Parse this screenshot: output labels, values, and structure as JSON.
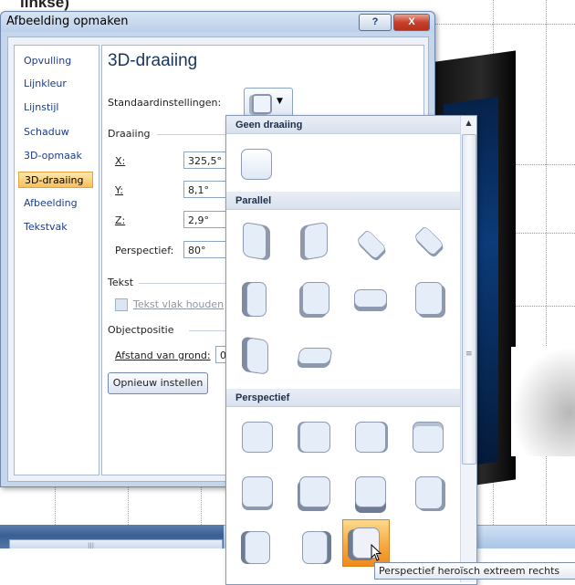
{
  "slide": {
    "top_text": "linkse)"
  },
  "dialog": {
    "title": "Afbeelding opmaken",
    "help_label": "?",
    "close_label": "X",
    "nav": [
      {
        "label": "Opvulling"
      },
      {
        "label": "Lijnkleur"
      },
      {
        "label": "Lijnstijl"
      },
      {
        "label": "Schaduw"
      },
      {
        "label": "3D-opmaak"
      },
      {
        "label": "3D-draaiing",
        "selected": true
      },
      {
        "label": "Afbeelding"
      },
      {
        "label": "Tekstvak"
      }
    ],
    "panel": {
      "heading": "3D-draaiing",
      "presets_label": "Standaardinstellingen:",
      "rotation_group": "Draaiing",
      "x_label": "X:",
      "x_value": "325,5°",
      "y_label": "Y:",
      "y_value": "8,1°",
      "z_label": "Z:",
      "z_value": "2,9°",
      "perspective_label": "Perspectief:",
      "perspective_value": "80°",
      "text_group": "Tekst",
      "keep_text_flat_label": "Tekst vlak houden",
      "object_position_group": "Objectpositie",
      "distance_label": "Afstand van grond:",
      "distance_value": "0",
      "reset_label": "Opnieuw instellen"
    }
  },
  "gallery": {
    "sections": [
      {
        "title": "Geen draaiing"
      },
      {
        "title": "Parallel"
      },
      {
        "title": "Perspectief"
      }
    ],
    "tooltip": "Perspectief heroïsch extreem rechts"
  },
  "colors": {
    "selection": "#f8c05a",
    "hover": "#f6a941",
    "dialog_border": "#6e87ac"
  }
}
